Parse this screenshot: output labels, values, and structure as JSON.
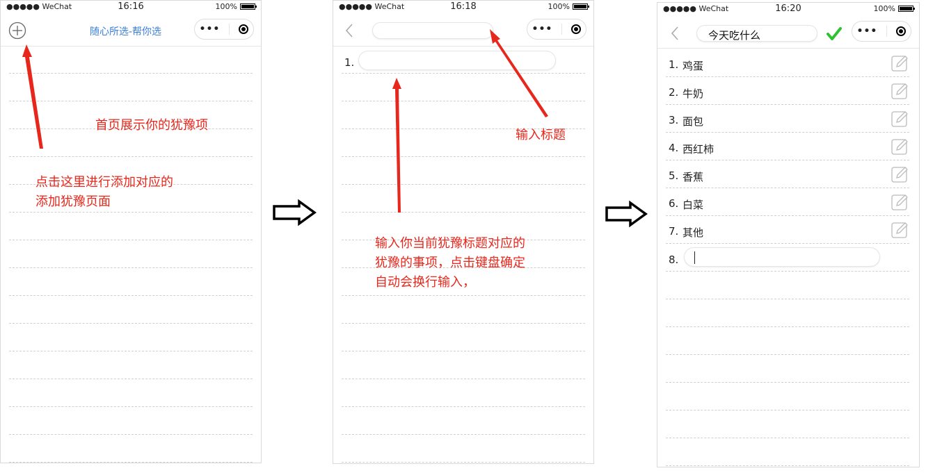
{
  "status": {
    "carrier": "●●●●● WeChat",
    "battery": "100%"
  },
  "screens": [
    {
      "time": "16:16",
      "title": "随心所选-帮你选"
    },
    {
      "time": "16:18",
      "first_index": "1."
    },
    {
      "time": "16:20",
      "title_value": "今天吃什么",
      "items": [
        {
          "index": "1.",
          "text": "鸡蛋"
        },
        {
          "index": "2.",
          "text": "牛奶"
        },
        {
          "index": "3.",
          "text": "面包"
        },
        {
          "index": "4.",
          "text": "西红柿"
        },
        {
          "index": "5.",
          "text": "香蕉"
        },
        {
          "index": "6.",
          "text": "白菜"
        },
        {
          "index": "7.",
          "text": "其他"
        }
      ],
      "new_index": "8."
    }
  ],
  "annotations": {
    "home_items": "首页展示你的犹豫项",
    "add_hint_line1": "点击这里进行添加对应的",
    "add_hint_line2": "添加犹豫页面",
    "input_title": "输入标题",
    "input_items_line1": "输入你当前犹豫标题对应的",
    "input_items_line2": "犹豫的事项，点击键盘确定",
    "input_items_line3": "自动会换行输入，"
  },
  "colors": {
    "annotation": "#e8271c",
    "title_blue": "#3b7fd9",
    "check_green": "#2fc22f"
  }
}
